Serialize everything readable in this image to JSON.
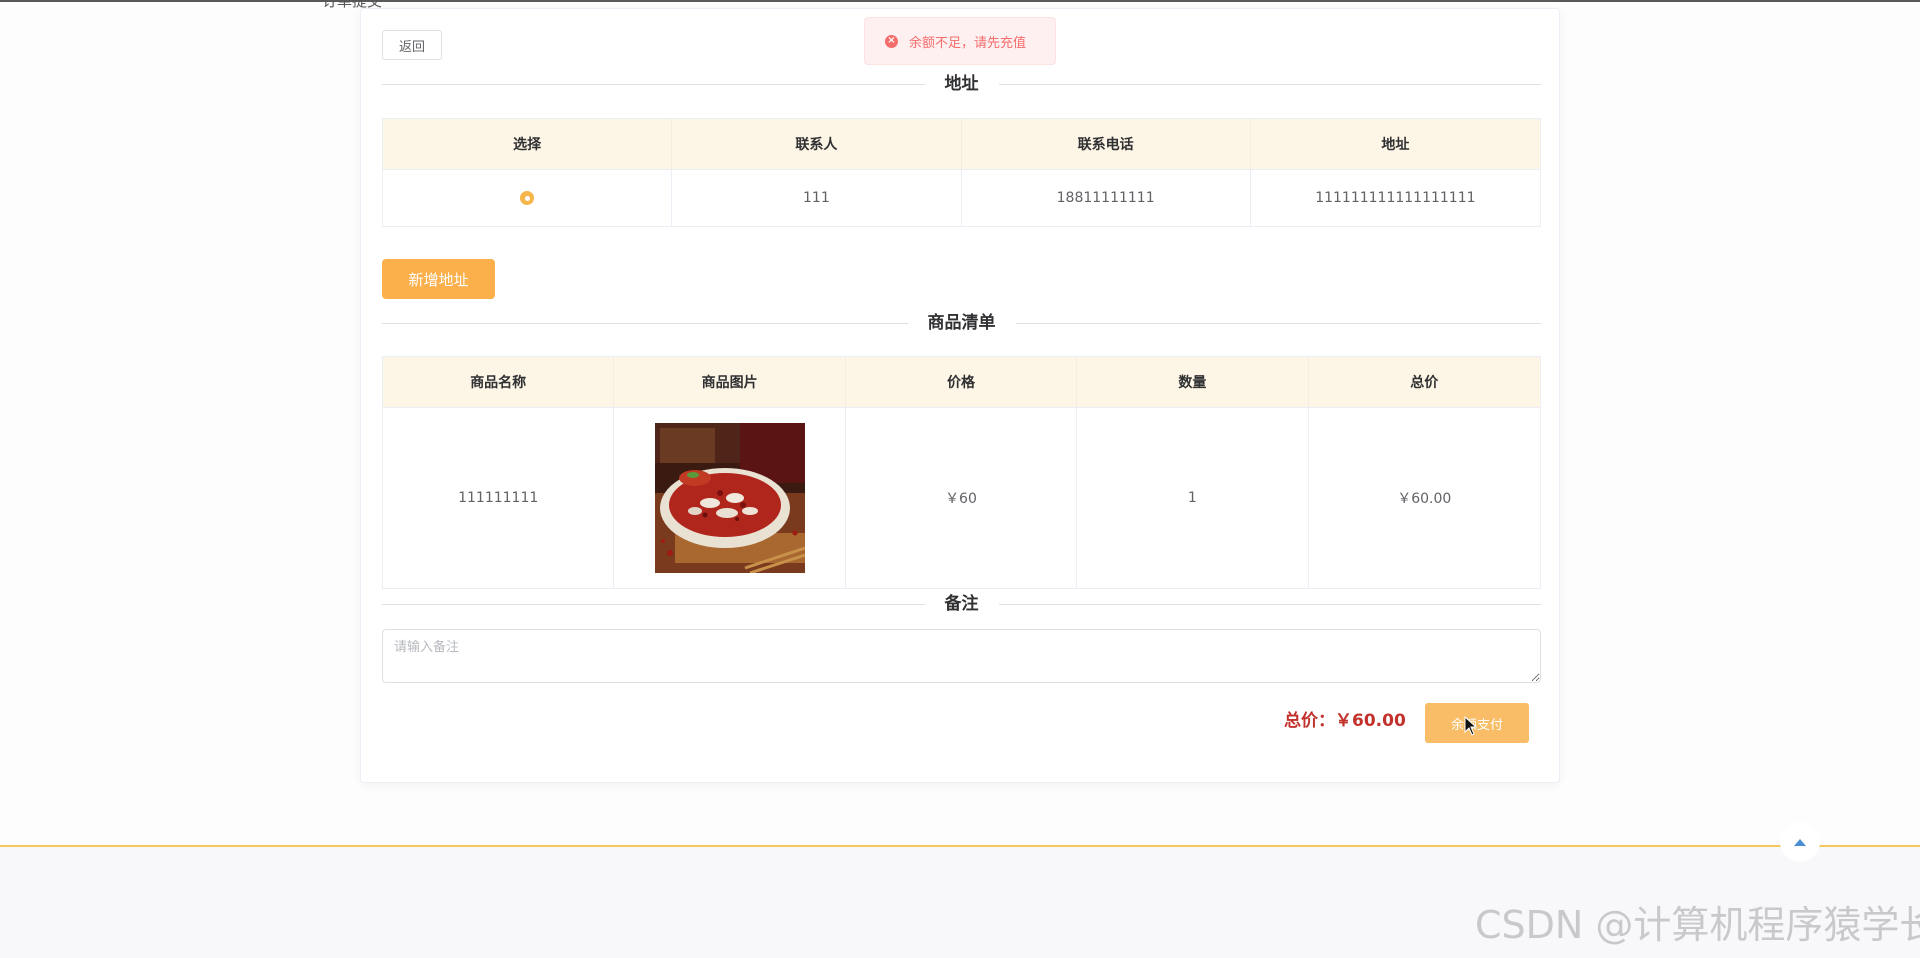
{
  "page": {
    "title_partial": "订单提交"
  },
  "toolbar": {
    "back_label": "返回"
  },
  "toast": {
    "message": "余额不足，请先充值",
    "icon": "error-circle-icon",
    "color": "#f56c6c"
  },
  "address_section": {
    "title": "地址",
    "columns": [
      "选择",
      "联系人",
      "联系电话",
      "地址"
    ],
    "rows": [
      {
        "selected": true,
        "contact": "111",
        "phone": "18811111111",
        "address": "111111111111111111"
      }
    ],
    "add_button_label": "新增地址"
  },
  "goods_section": {
    "title": "商品清单",
    "columns": [
      "商品名称",
      "商品图片",
      "价格",
      "数量",
      "总价"
    ],
    "rows": [
      {
        "name": "111111111",
        "image": "spicy-fish-hotpot-image",
        "price": "￥60",
        "quantity": "1",
        "total": "￥60.00"
      }
    ]
  },
  "note_section": {
    "title": "备注",
    "placeholder": "请输入备注",
    "value": ""
  },
  "summary": {
    "total_label": "总价：",
    "total_value": "￥60.00",
    "pay_button_label": "余额支付"
  },
  "watermark": "CSDN @计算机程序猿学长",
  "colors": {
    "accent": "#fbb04b",
    "header_bg": "#fdf5e6",
    "total_text": "#c2312b",
    "footer_border": "#f3c75a"
  }
}
